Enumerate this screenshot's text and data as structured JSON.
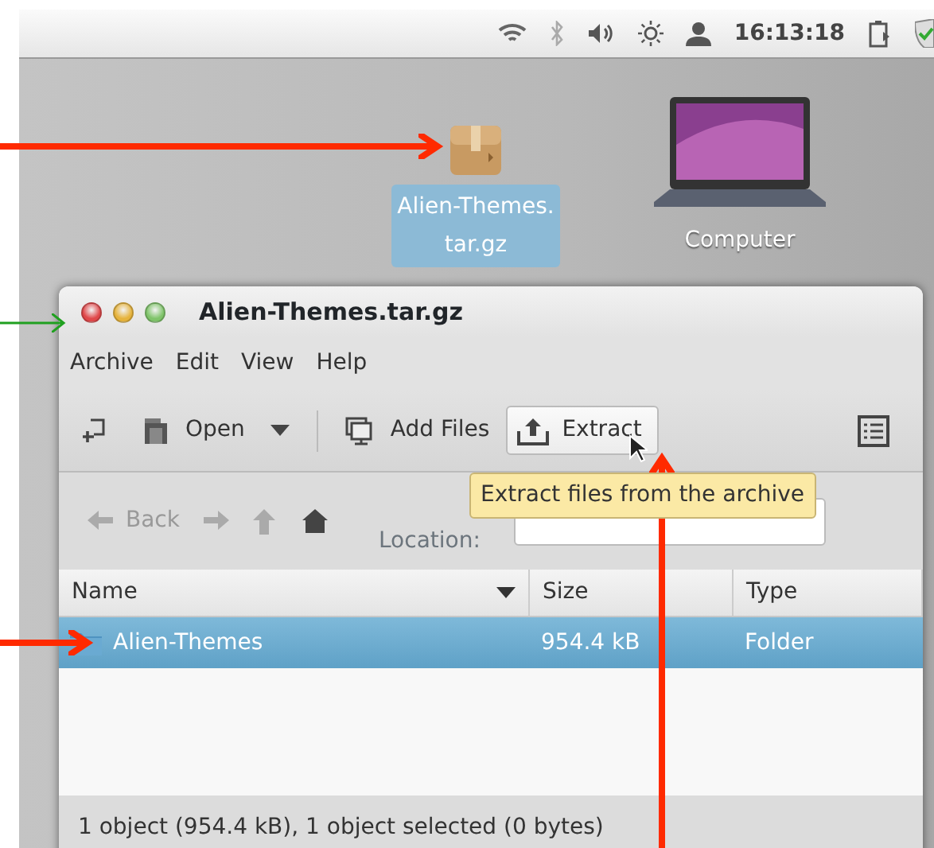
{
  "top_panel": {
    "clock": "16:13:18"
  },
  "desktop_icons": [
    {
      "kind": "archive",
      "label_lines": [
        "Alien-Themes.",
        "tar.gz"
      ],
      "selected": true
    },
    {
      "kind": "laptop",
      "label_lines": [
        "Computer"
      ],
      "selected": false
    }
  ],
  "window": {
    "title": "Alien-Themes.tar.gz",
    "menu": [
      "Archive",
      "Edit",
      "View",
      "Help"
    ],
    "toolbar": [
      {
        "kind": "new",
        "hovered": false
      },
      {
        "kind": "open",
        "label": "Open",
        "hovered": false
      },
      {
        "kind": "dropdown"
      },
      {
        "kind": "separator"
      },
      {
        "kind": "add",
        "label": "Add Files",
        "hovered": false
      },
      {
        "kind": "extract",
        "label": "Extract",
        "hovered": true
      }
    ],
    "tooltip": "Extract files from the archive",
    "nav": [
      {
        "kind": "back",
        "label": "Back",
        "disabled": true
      },
      {
        "kind": "forward",
        "disabled": true
      },
      {
        "kind": "up",
        "disabled": true
      },
      {
        "kind": "home",
        "disabled": false
      }
    ],
    "location_label": "Location:",
    "columns": [
      {
        "label": "Name",
        "sorted": true
      },
      {
        "label": "Size",
        "sorted": false
      },
      {
        "label": "Type",
        "sorted": false
      }
    ],
    "rows": [
      {
        "name": "Alien-Themes",
        "size": "954.4 kB",
        "type": "Folder",
        "selected": true
      }
    ],
    "status_bar": "1 object (954.4 kB), 1 object selected (0 bytes)"
  }
}
